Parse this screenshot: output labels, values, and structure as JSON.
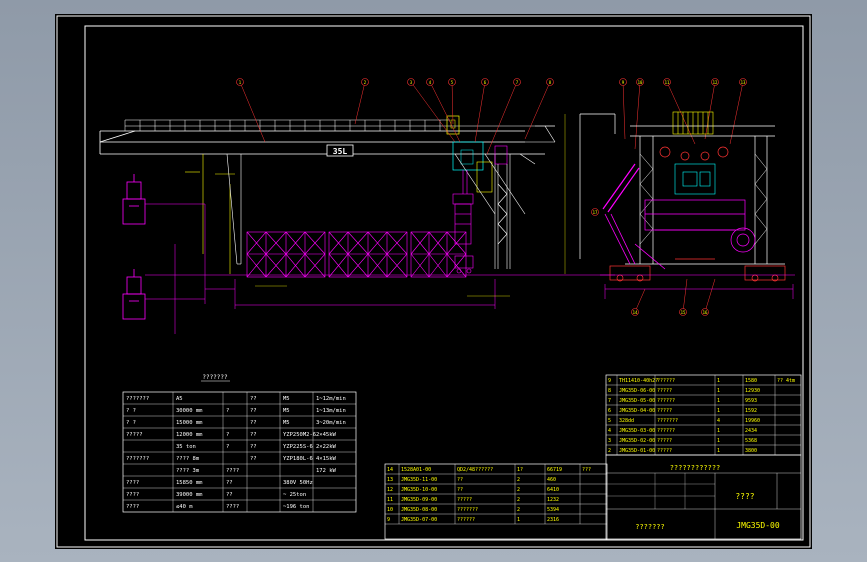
{
  "view_label": "???????",
  "span_label": "35L",
  "drawing_number": "JMG35D-00",
  "title_cell": "????",
  "company_cell": "???????",
  "header_row": "????????????",
  "balloons": [
    "1",
    "2",
    "3",
    "4",
    "5",
    "6",
    "7",
    "8",
    "9",
    "10",
    "11",
    "12",
    "13",
    "14",
    "15",
    "16",
    "17"
  ],
  "spec_rows": [
    {
      "c1": "???????",
      "c2": "A5",
      "c3": "",
      "c4": "??",
      "c5": "M5",
      "c6": "1~12m/min"
    },
    {
      "c1": "? ?",
      "c2": "30000 mm",
      "c3": "?",
      "c4": "??",
      "c5": "M5",
      "c6": "1~13m/min"
    },
    {
      "c1": "? ?",
      "c2": "15000 mm",
      "c3": "",
      "c4": "??",
      "c5": "M5",
      "c6": "3~20m/min"
    },
    {
      "c1": "?????",
      "c2": "12000 mm",
      "c3": "?",
      "c4": "??",
      "c5": "YZP250M2-6",
      "c6": "2×45kW"
    },
    {
      "c1": "",
      "c2": "35 ton",
      "c3": "?",
      "c4": "??",
      "c5": "YZP225S-6",
      "c6": "2×22kW"
    },
    {
      "c1": "???????",
      "c2": "????  8m",
      "c3": "",
      "c4": "??",
      "c5": "YZP180L-6",
      "c6": "4×15kW"
    },
    {
      "c1": "",
      "c2": "????  3m",
      "c3": "????",
      "c4": "",
      "c5": "",
      "c6": "172 kW"
    },
    {
      "c1": "????",
      "c2": "15850 mm",
      "c3": "??",
      "c4": "",
      "c5": "380V 50Hz",
      "c6": ""
    },
    {
      "c1": "????",
      "c2": "39000 mm",
      "c3": "??",
      "c4": "",
      "c5": "~ 25ton",
      "c6": ""
    },
    {
      "c1": "????",
      "c2": "≤40 m",
      "c3": "????",
      "c4": "",
      "c5": "~196 ton",
      "c6": ""
    }
  ],
  "bom_upper": [
    {
      "no": "9",
      "code": "TH11410-40h2?",
      "name": "??????",
      "qty": "1",
      "wt": "1580",
      "note": "?? 4tm"
    },
    {
      "no": "8",
      "code": "JMG35D-06-00",
      "name": "?????",
      "qty": "1",
      "wt": "12930",
      "note": ""
    },
    {
      "no": "7",
      "code": "JMG35D-05-00",
      "name": "??????",
      "qty": "1",
      "wt": "9593",
      "note": ""
    },
    {
      "no": "6",
      "code": "JMG35D-04-00",
      "name": "?????",
      "qty": "1",
      "wt": "1592",
      "note": ""
    },
    {
      "no": "5",
      "code": "328dd",
      "name": "???????",
      "qty": "4",
      "wt": "19960",
      "note": ""
    },
    {
      "no": "4",
      "code": "JMG35D-03-00",
      "name": "??????",
      "qty": "1",
      "wt": "2434",
      "note": ""
    },
    {
      "no": "3",
      "code": "JMG35D-02-00",
      "name": "?????",
      "qty": "1",
      "wt": "5368",
      "note": ""
    },
    {
      "no": "2",
      "code": "JMG35D-01-00",
      "name": "?????",
      "qty": "1",
      "wt": "3800",
      "note": ""
    }
  ],
  "bom_lower": [
    {
      "no": "14",
      "code": "1528A01-00",
      "name": "QD2/48??????",
      "qty": "1?",
      "wt": "66719",
      "note": "???"
    },
    {
      "no": "13",
      "code": "JMG35D-11-00",
      "name": "??",
      "qty": "2",
      "wt": "460",
      "note": ""
    },
    {
      "no": "12",
      "code": "JMG35D-10-00",
      "name": "??",
      "qty": "2",
      "wt": "6410",
      "note": ""
    },
    {
      "no": "11",
      "code": "JMG35D-09-00",
      "name": "?????",
      "qty": "2",
      "wt": "1232",
      "note": ""
    },
    {
      "no": "10",
      "code": "JMG35D-08-00",
      "name": "???????",
      "qty": "2",
      "wt": "5394",
      "note": ""
    },
    {
      "no": "9",
      "code": "JMG35D-07-00",
      "name": "??????",
      "qty": "1",
      "wt": "2316",
      "note": ""
    }
  ]
}
